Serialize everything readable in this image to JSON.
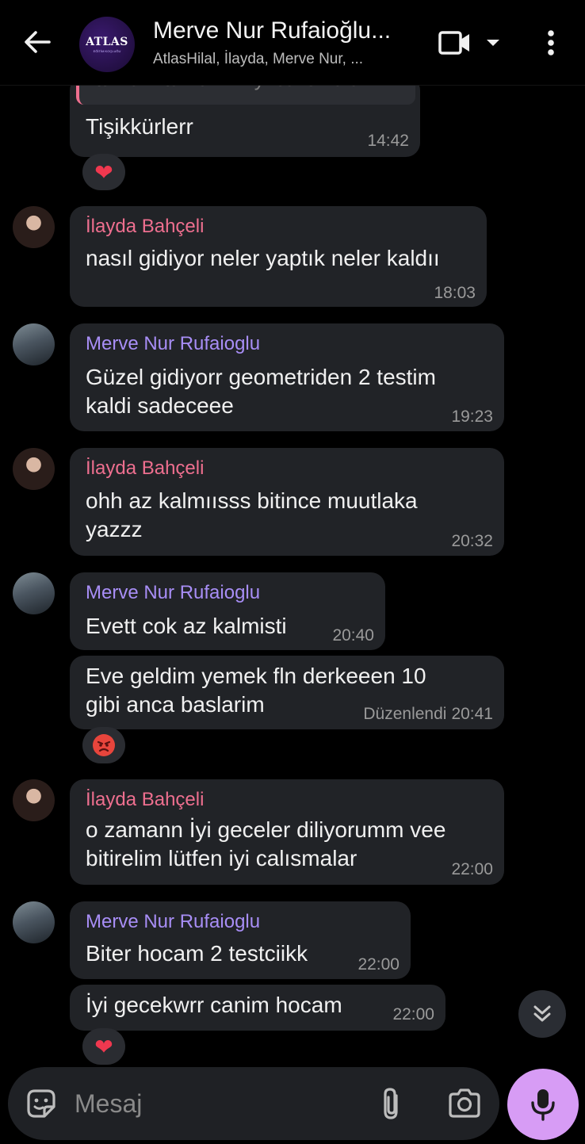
{
  "header": {
    "title": "Merve Nur Rufaioğlu...",
    "subtitle": "AtlasHilal, İlayda, Merve Nur, ...",
    "avatar_text": "ATLAS",
    "avatar_sub": "EĞİTİM KOÇLUĞU"
  },
  "quote": {
    "text": "tamam tamamm iyi calismalari"
  },
  "messages": [
    {
      "id": "m1",
      "text": "Tişikkürlerr",
      "time": "14:42",
      "reaction": "heart"
    },
    {
      "id": "m2",
      "sender": "İlayda Bahçeli",
      "text": "nasıl gidiyor neler yaptık neler kaldıı",
      "time": "18:03"
    },
    {
      "id": "m3",
      "sender": "Merve Nur Rufaioglu",
      "lines": [
        "Güzel gidiyorr geometriden 2 testim",
        "kaldi sadeceee"
      ],
      "time": "19:23"
    },
    {
      "id": "m4",
      "sender": "İlayda Bahçeli",
      "lines": [
        "ohh az kalmıısss bitince muutlaka",
        "yazzz"
      ],
      "time": "20:32"
    },
    {
      "id": "m5",
      "sender": "Merve Nur Rufaioglu",
      "text": "Evett cok az kalmisti",
      "time": "20:40"
    },
    {
      "id": "m6",
      "lines": [
        "Eve geldim yemek fln derkeeen 10",
        "gibi anca baslarim"
      ],
      "edited": "Düzenlendi",
      "time": "20:41",
      "reaction": "angry"
    },
    {
      "id": "m7",
      "sender": "İlayda Bahçeli",
      "lines": [
        "o zamann İyi geceler diliyorumm vee",
        "bitirelim lütfen iyi calısmalar"
      ],
      "time": "22:00"
    },
    {
      "id": "m8",
      "sender": "Merve Nur Rufaioglu",
      "text": "Biter hocam 2 testciikk",
      "time": "22:00"
    },
    {
      "id": "m9",
      "text": "İyi gecekwrr canim hocam",
      "time": "22:00",
      "reaction": "heart"
    }
  ],
  "input": {
    "placeholder": "Mesaj"
  },
  "colors": {
    "pink_sender": "#ee6f8f",
    "purple_sender": "#a88ef6",
    "bubble": "#212327",
    "mic": "#d79cf5"
  }
}
